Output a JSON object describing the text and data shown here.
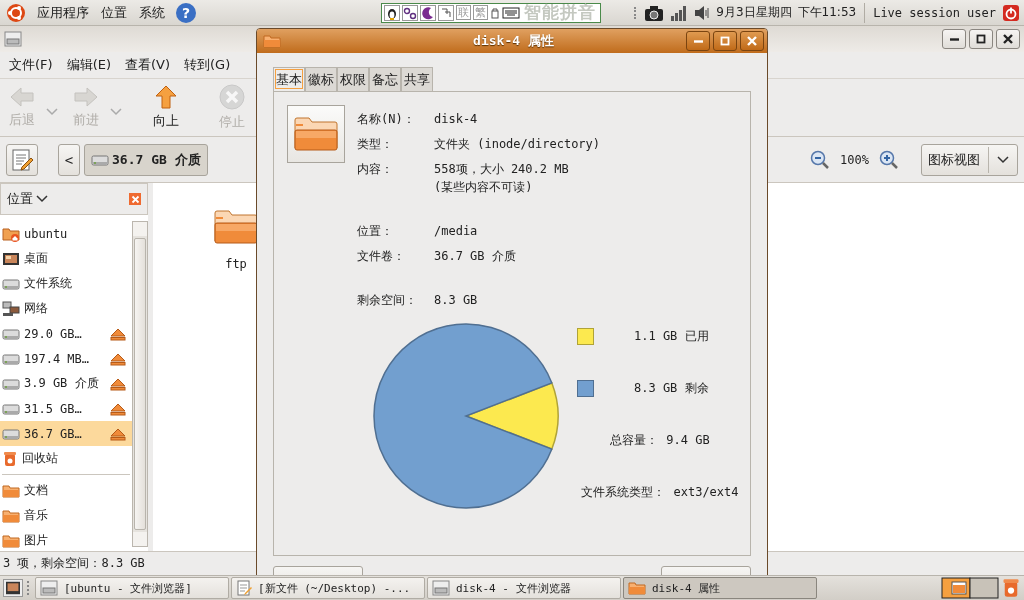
{
  "top_panel": {
    "menus": [
      "应用程序",
      "位置",
      "系统"
    ],
    "help": "?",
    "input_method": {
      "keys": [
        "联",
        "繁"
      ],
      "name": "智能拼音"
    },
    "date": "9月3日星期四",
    "time": "下午11:53",
    "user": "Live session user"
  },
  "browser": {
    "menus": [
      "文件(F)",
      "编辑(E)",
      "查看(V)",
      "转到(G)"
    ],
    "toolbar": [
      {
        "kind": "back",
        "label": "后退",
        "disabled": true,
        "has_menu": true
      },
      {
        "kind": "forward",
        "label": "前进",
        "disabled": true,
        "has_menu": true
      },
      {
        "kind": "up",
        "label": "向上",
        "disabled": false,
        "has_menu": false
      },
      {
        "kind": "stop",
        "label": "停止",
        "disabled": true,
        "has_menu": false
      }
    ],
    "back_glyph": "<",
    "path_button": "36.7 GB 介质",
    "zoom": "100%",
    "view_mode": "图标视图",
    "sidebar": {
      "title": "位置",
      "sections": [
        {
          "items": [
            {
              "kind": "home",
              "label": "ubuntu",
              "eject": false,
              "selected": false
            },
            {
              "kind": "desktop",
              "label": "桌面",
              "eject": false,
              "selected": false
            },
            {
              "kind": "drive",
              "label": "文件系统",
              "eject": false,
              "selected": false
            },
            {
              "kind": "network",
              "label": "网络",
              "eject": false,
              "selected": false
            },
            {
              "kind": "drive",
              "label": "29.0 GB…",
              "eject": true,
              "selected": false
            },
            {
              "kind": "drive",
              "label": "197.4 MB…",
              "eject": true,
              "selected": false
            },
            {
              "kind": "drive",
              "label": "3.9 GB 介质",
              "eject": true,
              "selected": false
            },
            {
              "kind": "drive",
              "label": "31.5 GB…",
              "eject": true,
              "selected": false
            },
            {
              "kind": "drive",
              "label": "36.7 GB…",
              "eject": true,
              "selected": true
            },
            {
              "kind": "trash",
              "label": "回收站",
              "eject": false,
              "selected": false
            }
          ]
        },
        {
          "items": [
            {
              "kind": "folder",
              "label": "文档",
              "eject": false,
              "selected": false
            },
            {
              "kind": "folder",
              "label": "音乐",
              "eject": false,
              "selected": false
            },
            {
              "kind": "folder",
              "label": "图片",
              "eject": false,
              "selected": false
            }
          ]
        }
      ]
    },
    "files": [
      {
        "name": "ftp"
      }
    ],
    "status": "3 项，剩余空间：8.3 GB"
  },
  "dialog": {
    "title": "disk-4 属性",
    "tabs": [
      {
        "label": "基本",
        "selected": true
      },
      {
        "label": "徽标",
        "selected": false
      },
      {
        "label": "权限",
        "selected": false
      },
      {
        "label": "备忘",
        "selected": false
      },
      {
        "label": "共享",
        "selected": false
      }
    ],
    "info_groups": [
      [
        {
          "label": "名称(N)：",
          "value": "disk-4"
        },
        {
          "label": "类型：",
          "value": "文件夹 (inode/directory)"
        },
        {
          "label": "内容：",
          "value": "558项，大小 240.2 MB",
          "note": "(某些内容不可读)"
        }
      ],
      [
        {
          "label": "位置：",
          "value": "/media"
        },
        {
          "label": "文件卷：",
          "value": "36.7 GB 介质"
        }
      ],
      [
        {
          "label": "剩余空间：",
          "value": "8.3 GB"
        }
      ]
    ],
    "chart_data": {
      "type": "pie",
      "values": [
        11.7,
        88.3
      ]
    },
    "legend": [
      {
        "label": "1.1 GB 已用",
        "color": "#fce94f"
      },
      {
        "label": "8.3 GB 剩余",
        "color": "#729fcf"
      }
    ],
    "total": {
      "label": "总容量：",
      "value": "9.4 GB"
    },
    "fs_type": {
      "label": "文件系统类型：",
      "value": "ext3/ext4"
    }
  },
  "taskbar": {
    "tasks": [
      {
        "kind": "browser",
        "label": "[ubuntu - 文件浏览器]",
        "selected": false
      },
      {
        "kind": "editor",
        "label": "[新文件 (~/Desktop) -...",
        "selected": false
      },
      {
        "kind": "browser",
        "label": "disk-4 - 文件浏览器",
        "selected": false
      },
      {
        "kind": "folder",
        "label": "disk-4 属性",
        "selected": true
      }
    ]
  }
}
